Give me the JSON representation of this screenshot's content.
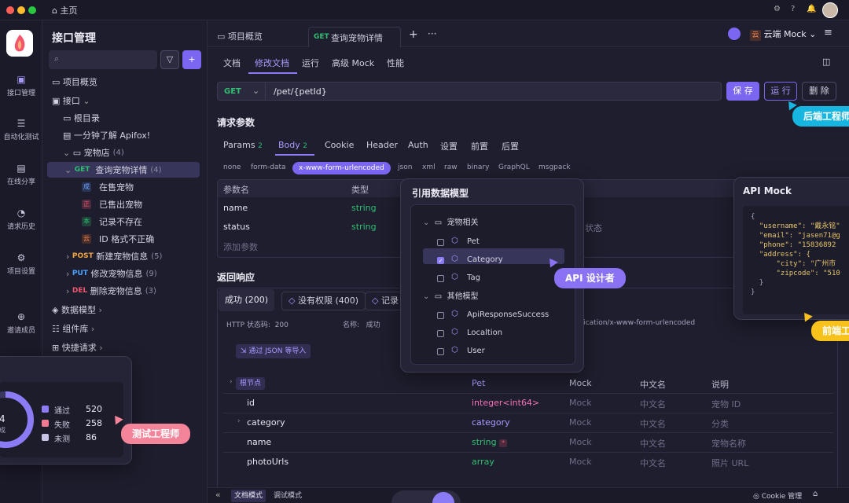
{
  "titlebar": {
    "home": "主页"
  },
  "rail": [
    "接口管理",
    "自动化测试",
    "在线分享",
    "请求历史",
    "项目设置",
    "邀请成员"
  ],
  "sidebar": {
    "title": "接口管理",
    "overview": "项目概览",
    "api": "接口",
    "root": "根目录",
    "intro": "一分钟了解 Apifox!",
    "petstore": "宠物店",
    "petstore_count": "(4)",
    "detail": {
      "method": "GET",
      "name": "查询宠物详情",
      "count": "(4)"
    },
    "cases": [
      {
        "tag": "成",
        "name": "在售宠物"
      },
      {
        "tag": "正",
        "name": "已售出宠物"
      },
      {
        "tag": "本",
        "name": "记录不存在"
      },
      {
        "tag": "云",
        "name": "ID 格式不正确"
      }
    ],
    "others": [
      {
        "method": "POST",
        "name": "新建宠物信息",
        "count": "(5)"
      },
      {
        "method": "PUT",
        "name": "修改宠物信息",
        "count": "(9)"
      },
      {
        "method": "DEL",
        "name": "删除宠物信息",
        "count": "(3)"
      }
    ],
    "models": "数据模型",
    "components": "组件库",
    "quick": "快捷请求"
  },
  "tabs": {
    "overview": "项目概览",
    "active_method": "GET",
    "active": "查询宠物详情",
    "env_tag": "云",
    "env": "云端 Mock"
  },
  "subtabs": [
    "文档",
    "修改文档",
    "运行",
    "高级 Mock",
    "性能"
  ],
  "request": {
    "method": "GET",
    "path": "/pet/{petId}",
    "save": "保 存",
    "run": "运 行",
    "delete": "删 除"
  },
  "params": {
    "title": "请求参数",
    "tabs": [
      {
        "label": "Params",
        "count": "2"
      },
      {
        "label": "Body",
        "count": "2"
      },
      {
        "label": "Cookie",
        "count": ""
      },
      {
        "label": "Header",
        "count": ""
      },
      {
        "label": "Auth",
        "count": ""
      },
      {
        "label": "设置",
        "count": ""
      },
      {
        "label": "前置",
        "count": ""
      },
      {
        "label": "后置",
        "count": ""
      }
    ],
    "body_types": [
      "none",
      "form-data",
      "x-www-form-urlencoded",
      "json",
      "xml",
      "raw",
      "binary",
      "GraphQL",
      "msgpack"
    ],
    "header_name": "参数名",
    "header_type": "类型",
    "rows": [
      {
        "name": "name",
        "type": "string"
      },
      {
        "name": "status",
        "type": "string"
      }
    ],
    "status_note": "状态",
    "add": "添加参数"
  },
  "response": {
    "title": "返回响应",
    "tabs": [
      "成功 (200)",
      "没有权限 (400)",
      "记录"
    ],
    "status_label": "HTTP 状态码:",
    "status_value": "200",
    "name_label": "名称:",
    "name_value": "成功",
    "content_type": "plication/x-www-form-urlencoded",
    "import": "通过 JSON 等导入",
    "root_node": "根节点",
    "cols": [
      "Pet",
      "Mock",
      "中文名",
      "说明"
    ],
    "rows": [
      {
        "name": "id",
        "type": "integer<int64>",
        "mock": "Mock",
        "cn": "中文名",
        "desc": "宠物 ID"
      },
      {
        "name": "category",
        "type": "category",
        "mock": "Mock",
        "cn": "中文名",
        "desc": "分类"
      },
      {
        "name": "name",
        "type": "string",
        "mock": "Mock",
        "cn": "中文名",
        "desc": "宠物名称"
      },
      {
        "name": "photoUrls",
        "type": "array",
        "mock": "Mock",
        "cn": "中文名",
        "desc": "照片 URL"
      }
    ]
  },
  "model_popup": {
    "title": "引用数据模型",
    "groups": [
      {
        "name": "宠物相关",
        "items": [
          {
            "label": "Pet",
            "checked": false
          },
          {
            "label": "Category",
            "checked": true
          },
          {
            "label": "Tag",
            "checked": false
          }
        ]
      },
      {
        "name": "其他模型",
        "items": [
          {
            "label": "ApiResponseSuccess",
            "checked": false
          },
          {
            "label": "Localtion",
            "checked": false
          },
          {
            "label": "User",
            "checked": false
          }
        ]
      }
    ]
  },
  "mock_popup": {
    "title": "API Mock",
    "lines": [
      "{",
      "  \"username\": \"戴永铭\"",
      "  \"email\": \"jasen71@g",
      "  \"phone\": \"15836892",
      "  \"address\": {",
      "      \"city\": \"广州市",
      "      \"zipcode\": \"510",
      "  }",
      "}"
    ]
  },
  "test_popup": {
    "center_value": "4",
    "center_label": "成",
    "stats": [
      {
        "label": "通过",
        "value": "520",
        "color": "#8b7cf6"
      },
      {
        "label": "失败",
        "value": "258",
        "color": "#f47a94"
      },
      {
        "label": "未测",
        "value": "86",
        "color": "#c7c4e8"
      }
    ]
  },
  "chips": {
    "backend": "后端工程师",
    "designer": "API 设计者",
    "frontend": "前端工",
    "tester": "测试工程师"
  },
  "bottom": {
    "doc_mode": "文档模式",
    "debug_mode": "调试模式",
    "cookie": "Cookie 管理"
  },
  "colors": {
    "accent": "#8b7cf6",
    "get": "#2fbf71",
    "post": "#f1a640",
    "put": "#4aa3ff",
    "del": "#f0566d",
    "backend_chip": "#16b6e0",
    "designer_chip": "#8b72f4",
    "frontend_chip": "#f8c21c",
    "tester_chip": "#f4849a"
  }
}
